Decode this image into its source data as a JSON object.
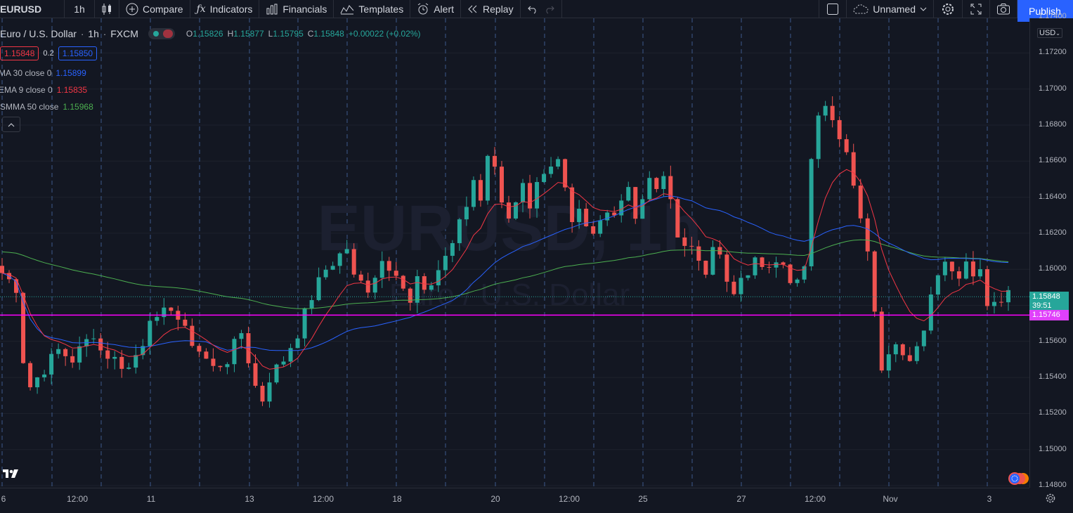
{
  "toolbar": {
    "symbol": "EURUSD",
    "interval": "1h",
    "compare_label": "Compare",
    "indicators_label": "Indicators",
    "financials_label": "Financials",
    "templates_label": "Templates",
    "alert_label": "Alert",
    "replay_label": "Replay",
    "layout_name": "Unnamed",
    "publish_label": "Publish"
  },
  "legend": {
    "title": "Euro / U.S. Dollar",
    "interval": "1h",
    "exchange": "FXCM",
    "o_label": "O",
    "o_value": "1.15826",
    "h_label": "H",
    "h_value": "1.15877",
    "l_label": "L",
    "l_value": "1.15795",
    "c_label": "C",
    "c_value": "1.15848",
    "change": "+0.00022 (+0.02%)",
    "sell_price": "1.15848",
    "spread": "0.2",
    "buy_price": "1.15850",
    "indicators": [
      {
        "name": "MA 30 close 0",
        "value": "1.15899",
        "color": "#2962ff"
      },
      {
        "name": "EMA 9 close 0",
        "value": "1.15835",
        "color": "#f23645"
      },
      {
        "name": "SMMA 50 close",
        "value": "1.15968",
        "color": "#4caf50"
      }
    ]
  },
  "watermark": {
    "symbol": "EURUSD, 1h",
    "description": "Euro / U.S. Dollar"
  },
  "price_axis": {
    "currency": "USD",
    "ticks": [
      "1.17400",
      "1.17200",
      "1.17000",
      "1.16800",
      "1.16600",
      "1.16400",
      "1.16200",
      "1.16000",
      "1.15800",
      "1.15600",
      "1.15400",
      "1.15200",
      "1.15000",
      "1.14800"
    ],
    "last_price": "1.15848",
    "countdown": "39:51",
    "line_price": "1.15746"
  },
  "time_axis": {
    "ticks": [
      "6",
      "12:00",
      "11",
      "13",
      "12:00",
      "18",
      "20",
      "12:00",
      "25",
      "27",
      "12:00",
      "Nov",
      "3"
    ]
  },
  "colors": {
    "background": "#131722",
    "up": "#26a69a",
    "down": "#ef5350",
    "horizontal_line": "#ff00ff",
    "publish": "#2962ff"
  },
  "chart_data": {
    "type": "candlestick",
    "symbol": "EURUSD",
    "interval": "1h",
    "ylim": [
      1.148,
      1.1745
    ],
    "close_path": [
      [
        0,
        1.1598
      ],
      [
        2,
        1.159
      ],
      [
        3,
        1.155
      ],
      [
        4,
        1.1535
      ],
      [
        6,
        1.1545
      ],
      [
        8,
        1.1555
      ],
      [
        10,
        1.155
      ],
      [
        12,
        1.156
      ],
      [
        13,
        1.1565
      ],
      [
        14,
        1.1555
      ],
      [
        16,
        1.155
      ],
      [
        18,
        1.1545
      ],
      [
        20,
        1.156
      ],
      [
        21,
        1.1575
      ],
      [
        22,
        1.157
      ],
      [
        24,
        1.158
      ],
      [
        26,
        1.1565
      ],
      [
        28,
        1.1555
      ],
      [
        30,
        1.1545
      ],
      [
        32,
        1.155
      ],
      [
        34,
        1.1565
      ],
      [
        35,
        1.155
      ],
      [
        36,
        1.1535
      ],
      [
        37,
        1.1528
      ],
      [
        38,
        1.154
      ],
      [
        40,
        1.155
      ],
      [
        42,
        1.1565
      ],
      [
        44,
        1.1585
      ],
      [
        46,
        1.16
      ],
      [
        48,
        1.1608
      ],
      [
        49,
        1.1612
      ],
      [
        50,
        1.1595
      ],
      [
        52,
        1.159
      ],
      [
        54,
        1.1605
      ],
      [
        56,
        1.16
      ],
      [
        57,
        1.159
      ],
      [
        58,
        1.158
      ],
      [
        59,
        1.1595
      ],
      [
        60,
        1.1585
      ],
      [
        62,
        1.16
      ],
      [
        64,
        1.1615
      ],
      [
        66,
        1.1635
      ],
      [
        67,
        1.165
      ],
      [
        68,
        1.164
      ],
      [
        69,
        1.1665
      ],
      [
        70,
        1.1655
      ],
      [
        71,
        1.164
      ],
      [
        72,
        1.163
      ],
      [
        73,
        1.1635
      ],
      [
        74,
        1.1645
      ],
      [
        75,
        1.163
      ],
      [
        76,
        1.1645
      ],
      [
        77,
        1.165
      ],
      [
        78,
        1.1655
      ],
      [
        79,
        1.166
      ],
      [
        80,
        1.1645
      ],
      [
        81,
        1.163
      ],
      [
        82,
        1.1635
      ],
      [
        83,
        1.1625
      ],
      [
        84,
        1.1622
      ],
      [
        85,
        1.1628
      ],
      [
        86,
        1.163
      ],
      [
        87,
        1.1628
      ],
      [
        88,
        1.164
      ],
      [
        89,
        1.1642
      ],
      [
        90,
        1.1632
      ],
      [
        91,
        1.164
      ],
      [
        92,
        1.165
      ],
      [
        93,
        1.1645
      ],
      [
        94,
        1.1655
      ],
      [
        95,
        1.1635
      ],
      [
        96,
        1.1618
      ],
      [
        97,
        1.161
      ],
      [
        98,
        1.1612
      ],
      [
        99,
        1.1605
      ],
      [
        100,
        1.16
      ],
      [
        101,
        1.161
      ],
      [
        102,
        1.1605
      ],
      [
        103,
        1.1595
      ],
      [
        104,
        1.159
      ],
      [
        105,
        1.1598
      ],
      [
        106,
        1.1595
      ],
      [
        107,
        1.1605
      ],
      [
        108,
        1.16
      ],
      [
        109,
        1.1598
      ],
      [
        110,
        1.1606
      ],
      [
        111,
        1.16
      ],
      [
        112,
        1.1595
      ],
      [
        113,
        1.1598
      ],
      [
        114,
        1.1605
      ],
      [
        115,
        1.1665
      ],
      [
        116,
        1.1685
      ],
      [
        117,
        1.1688
      ],
      [
        118,
        1.168
      ],
      [
        119,
        1.1675
      ],
      [
        120,
        1.1665
      ],
      [
        121,
        1.165
      ],
      [
        122,
        1.163
      ],
      [
        123,
        1.161
      ],
      [
        124,
        1.158
      ],
      [
        125,
        1.1545
      ],
      [
        126,
        1.1555
      ],
      [
        127,
        1.156
      ],
      [
        128,
        1.155
      ],
      [
        129,
        1.1552
      ],
      [
        130,
        1.156
      ],
      [
        131,
        1.157
      ],
      [
        132,
        1.1585
      ],
      [
        133,
        1.16
      ],
      [
        134,
        1.1605
      ],
      [
        135,
        1.1602
      ],
      [
        136,
        1.1595
      ],
      [
        137,
        1.1605
      ],
      [
        138,
        1.16
      ],
      [
        139,
        1.1598
      ],
      [
        140,
        1.158
      ],
      [
        141,
        1.158
      ],
      [
        142,
        1.1583
      ],
      [
        143,
        1.1585
      ]
    ],
    "horizontal_line": 1.15746,
    "indicators": [
      {
        "name": "MA 30 close 0",
        "value": 1.15899
      },
      {
        "name": "EMA 9 close 0",
        "value": 1.15835
      },
      {
        "name": "SMMA 50 close",
        "value": 1.15968
      }
    ]
  }
}
